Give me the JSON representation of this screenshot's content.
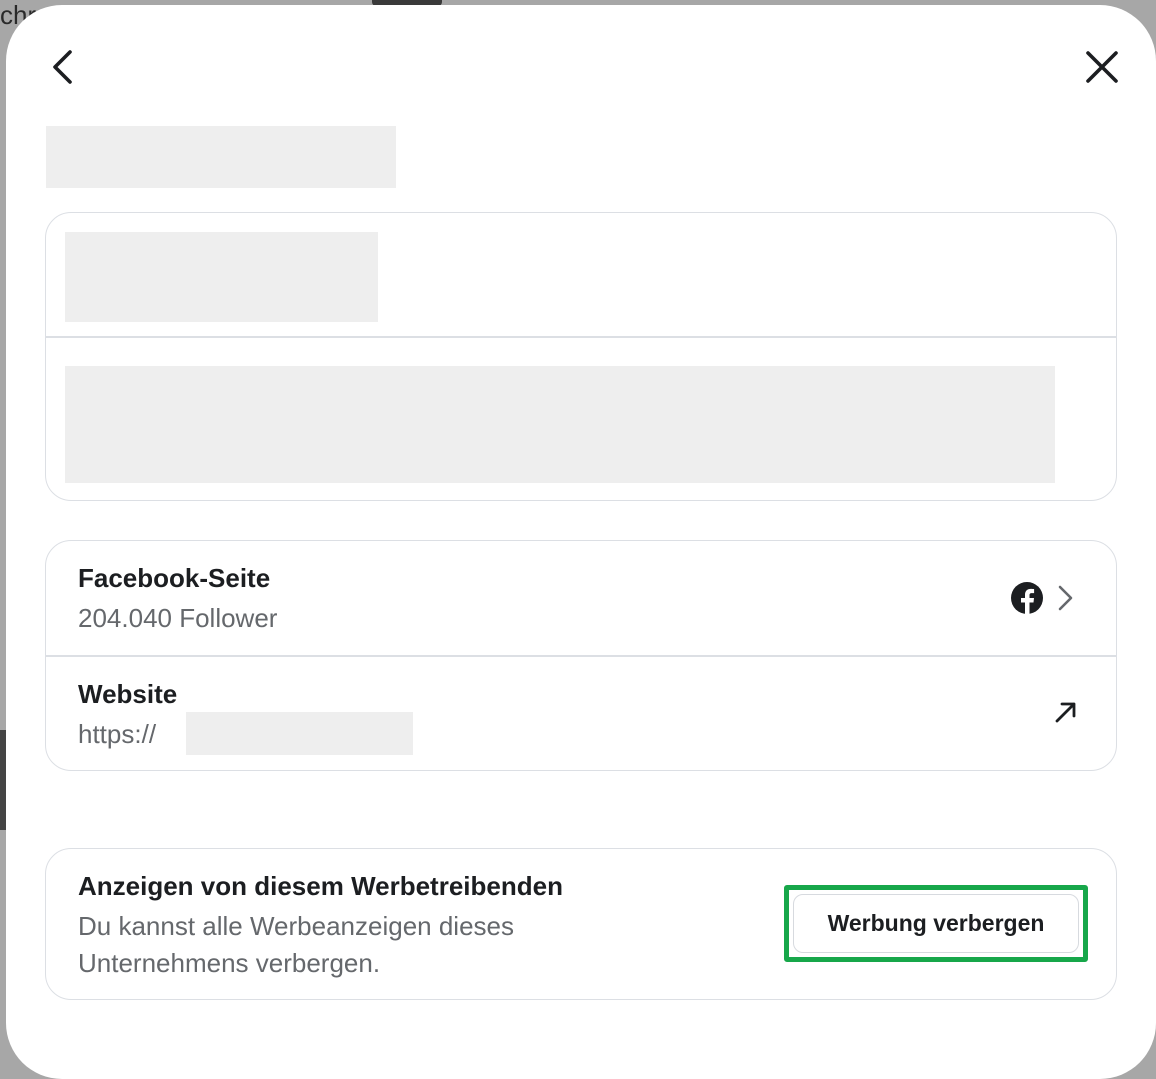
{
  "backdrop": {
    "visible_text": "chr"
  },
  "dialog": {
    "back_icon": "chevron-left-icon",
    "close_icon": "close-icon"
  },
  "facebook_page": {
    "title": "Facebook-Seite",
    "followers": "204.040 Follower",
    "icons": [
      "facebook-icon",
      "chevron-right-icon"
    ]
  },
  "website": {
    "title": "Website",
    "url_prefix": "https://",
    "icon": "external-arrow-icon"
  },
  "advertiser_ads": {
    "title": "Anzeigen von diesem Werbetreibenden",
    "description_line1": "Du kannst alle Werbeanzeigen dieses",
    "description_line2": "Unternehmens verbergen.",
    "hide_button_label": "Werbung verbergen"
  },
  "colors": {
    "highlight": "#17a74a",
    "placeholder": "#eeeeee",
    "secondary_text": "#65686c",
    "border": "#dcdfe4"
  }
}
